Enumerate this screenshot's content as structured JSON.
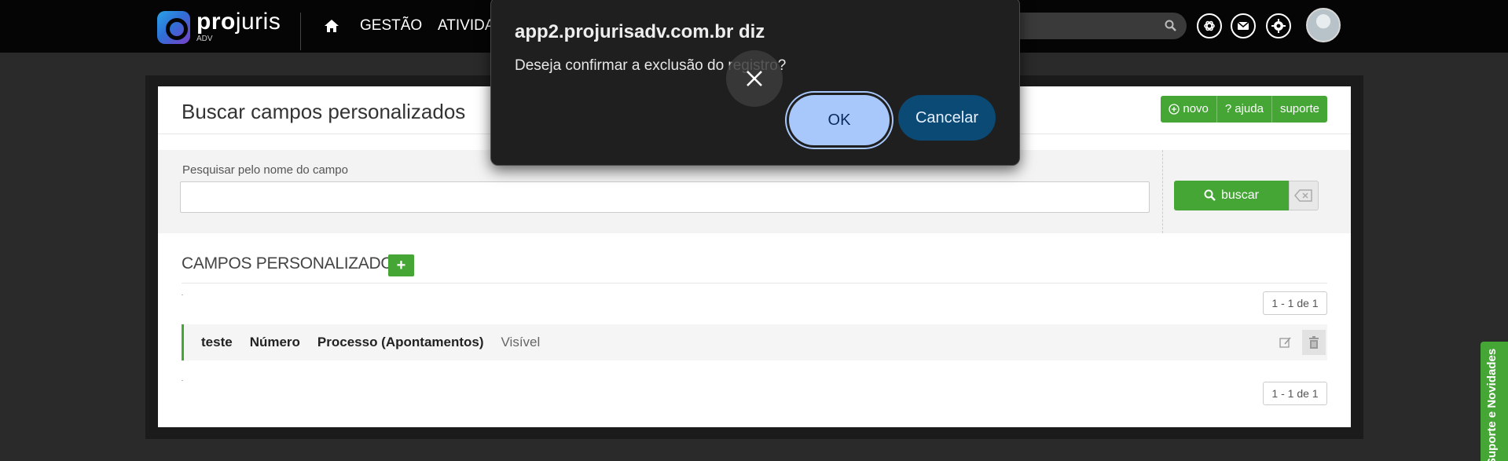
{
  "topbar": {
    "logo_name_bold": "pro",
    "logo_name_rest": "juris",
    "logo_sub": "ADV",
    "nav": [
      "GESTÃO",
      "ATIVIDA"
    ],
    "icons": [
      "home-icon",
      "search-icon",
      "openai-icon",
      "mail-icon",
      "settings-icon",
      "avatar"
    ]
  },
  "page": {
    "title": "Buscar campos personalizados",
    "buttons": {
      "novo": "novo",
      "ajuda": "ajuda",
      "suporte": "suporte"
    },
    "search": {
      "label": "Pesquisar pelo nome do campo",
      "value": "",
      "placeholder": "",
      "buscar": "buscar"
    },
    "section_title": "CAMPOS PERSONALIZADOS",
    "add_label": "+",
    "pager_top": "1 - 1 de 1",
    "pager_bottom": "1 - 1 de 1",
    "rows": [
      {
        "nome": "teste",
        "tipo": "Número",
        "entidade": "Processo (Apontamentos)",
        "visibilidade": "Visível"
      }
    ]
  },
  "side_tab": {
    "label": "Suporte e Novidades"
  },
  "dialog": {
    "title": "app2.projurisadv.com.br diz",
    "message": "Deseja confirmar a exclusão do registro?",
    "ok": "OK",
    "cancel": "Cancelar"
  },
  "colors": {
    "accent_green": "#45a535",
    "ok_blue": "#a8c7fa",
    "cancel_blue": "#0a4a75"
  }
}
